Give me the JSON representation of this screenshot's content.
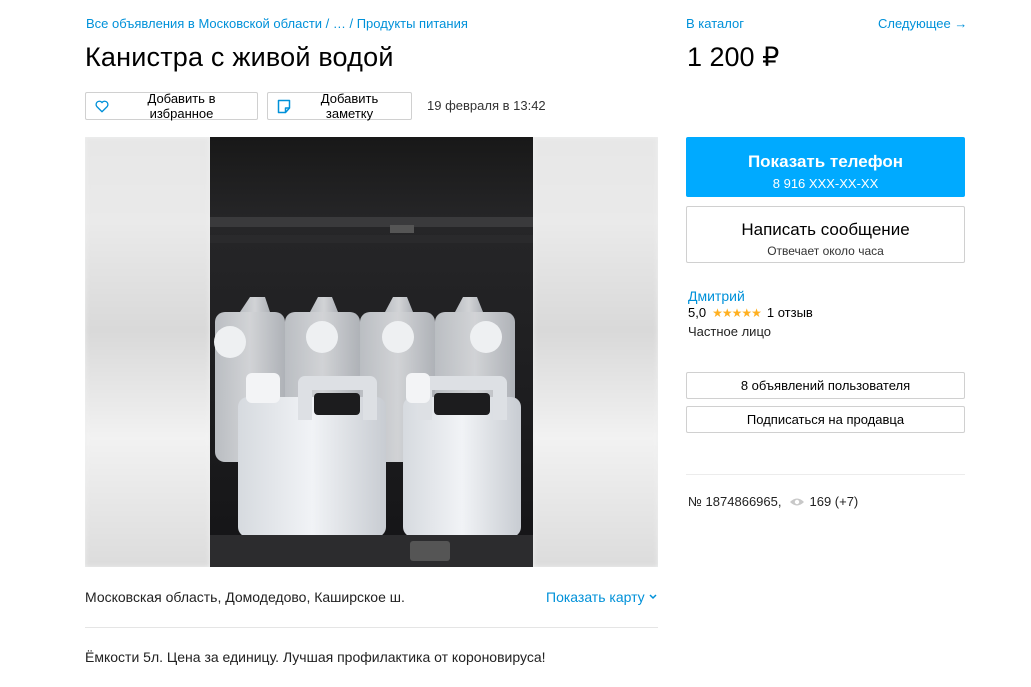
{
  "breadcrumb": {
    "text": "Все объявления в Московской области / … / Продукты питания"
  },
  "nav": {
    "catalog": "В каталог",
    "next": "Следующее →"
  },
  "listing": {
    "title": "Канистра с живой водой",
    "price": "1 200 ₽",
    "date": "19 февраля в 13:42",
    "location": "Московская область, Домодедово, Каширское ш.",
    "show_map": "Показать карту",
    "description": "Ёмкости 5л. Цена за единицу. Лучшая профилактика от короновируса!"
  },
  "actions": {
    "favorite": "Добавить в избранное",
    "note": "Добавить заметку"
  },
  "contact": {
    "phone_label": "Показать телефон",
    "phone_masked": "8 916 XXX-XX-XX",
    "message_label": "Написать сообщение",
    "message_sub": "Отвечает около часа"
  },
  "seller": {
    "name": "Дмитрий",
    "rating": "5,0",
    "stars": "★★★★★",
    "reviews": "1 отзыв",
    "type": "Частное лицо",
    "ads_button": "8 объявлений пользователя",
    "subscribe_button": "Подписаться на продавца"
  },
  "meta": {
    "id": "№ 1874866965,",
    "views": "169 (+7)"
  },
  "colors": {
    "link": "#0091d9",
    "primary_button": "#00aaff",
    "star": "#ffb021"
  }
}
